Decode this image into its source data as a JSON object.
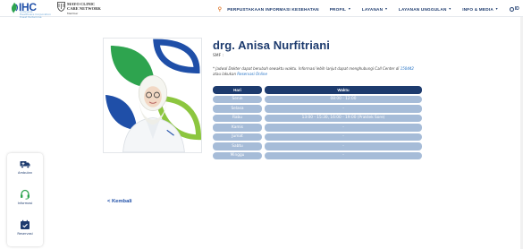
{
  "header": {
    "logo_ihc": {
      "word": "IHC",
      "tagline_1": "Indonesia",
      "tagline_2": "Healthcare Corporation",
      "tagline_3": "Pusat Pertamina"
    },
    "logo_mayo": {
      "line1": "MAYO CLINIC",
      "line2": "CARE NETWORK",
      "line3": "Member"
    },
    "nav": [
      {
        "label": "PERPUSTAKAAN INFORMASI KESEHATAN",
        "caret": false
      },
      {
        "label": "PROFIL",
        "caret": true
      },
      {
        "label": "LAYANAN",
        "caret": true
      },
      {
        "label": "LAYANAN UNGGULAN",
        "caret": true
      },
      {
        "label": "INFO & MEDIA",
        "caret": true
      }
    ],
    "lang": "ID",
    "caret_glyph": "▼",
    "pin_glyph": "⚲"
  },
  "doctor": {
    "name": "drg. Anisa Nurfitriani",
    "smf": "SMF :",
    "note_prefix": "* Jadwal Dokter dapat berubah sewaktu waktu. Informasi lebih lanjut dapat menghubungi Call Center di",
    "note_phone": "150442",
    "note_mid": "atau lakukan",
    "note_link": "Reservasi Online"
  },
  "schedule": {
    "headers": {
      "day": "Hari",
      "time": "Waktu"
    },
    "rows": [
      {
        "day": "Senin",
        "time": "08:00 - 12:00"
      },
      {
        "day": "Selasa",
        "time": "-"
      },
      {
        "day": "Rabu",
        "time": "13:00 - 15:30, 16:00 - 19:00 (Praktek Sore)"
      },
      {
        "day": "Kamis",
        "time": "-"
      },
      {
        "day": "Jumat",
        "time": "-"
      },
      {
        "day": "Sabtu",
        "time": "-"
      },
      {
        "day": "Minggu",
        "time": "-"
      }
    ]
  },
  "back_link": "< Kembali",
  "sidebar": {
    "items": [
      {
        "label": "Ambulan",
        "icon": "ambulance-icon"
      },
      {
        "label": "Informasi",
        "icon": "headset-icon"
      },
      {
        "label": "Reservasi",
        "icon": "calendar-check-icon"
      }
    ]
  },
  "colors": {
    "navy": "#1d3b6e",
    "cell_light": "#a6bcd8",
    "brand_blue": "#1f4fa8",
    "green": "#2ea44f",
    "orange": "#e07a2e"
  }
}
